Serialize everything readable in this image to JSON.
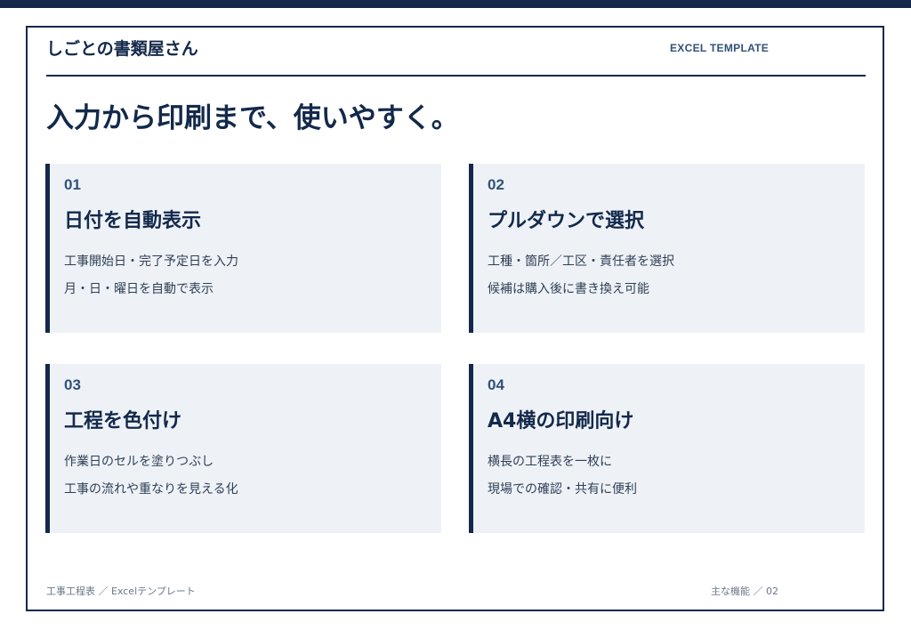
{
  "header": {
    "brand": "しごとの書類屋さん",
    "tag": "EXCEL TEMPLATE"
  },
  "headline": "入力から印刷まで、使いやすく。",
  "cards": [
    {
      "num": "01",
      "title": "日付を自動表示",
      "lines": [
        "工事開始日・完了予定日を入力",
        "月・日・曜日を自動で表示"
      ]
    },
    {
      "num": "02",
      "title": "プルダウンで選択",
      "lines": [
        "工種・箇所／工区・責任者を選択",
        "候補は購入後に書き換え可能"
      ]
    },
    {
      "num": "03",
      "title": "工程を色付け",
      "lines": [
        "作業日のセルを塗りつぶし",
        "工事の流れや重なりを見える化"
      ]
    },
    {
      "num": "04",
      "title": "A4横の印刷向け",
      "lines": [
        "横長の工程表を一枚に",
        "現場での確認・共有に便利"
      ]
    }
  ],
  "footer": {
    "left": "工事工程表 ／ Excelテンプレート",
    "right": "主な機能 ／ 02"
  },
  "colors": {
    "navy": "#13294b",
    "card_bg": "#eef2f7",
    "accent": "#30527a"
  }
}
